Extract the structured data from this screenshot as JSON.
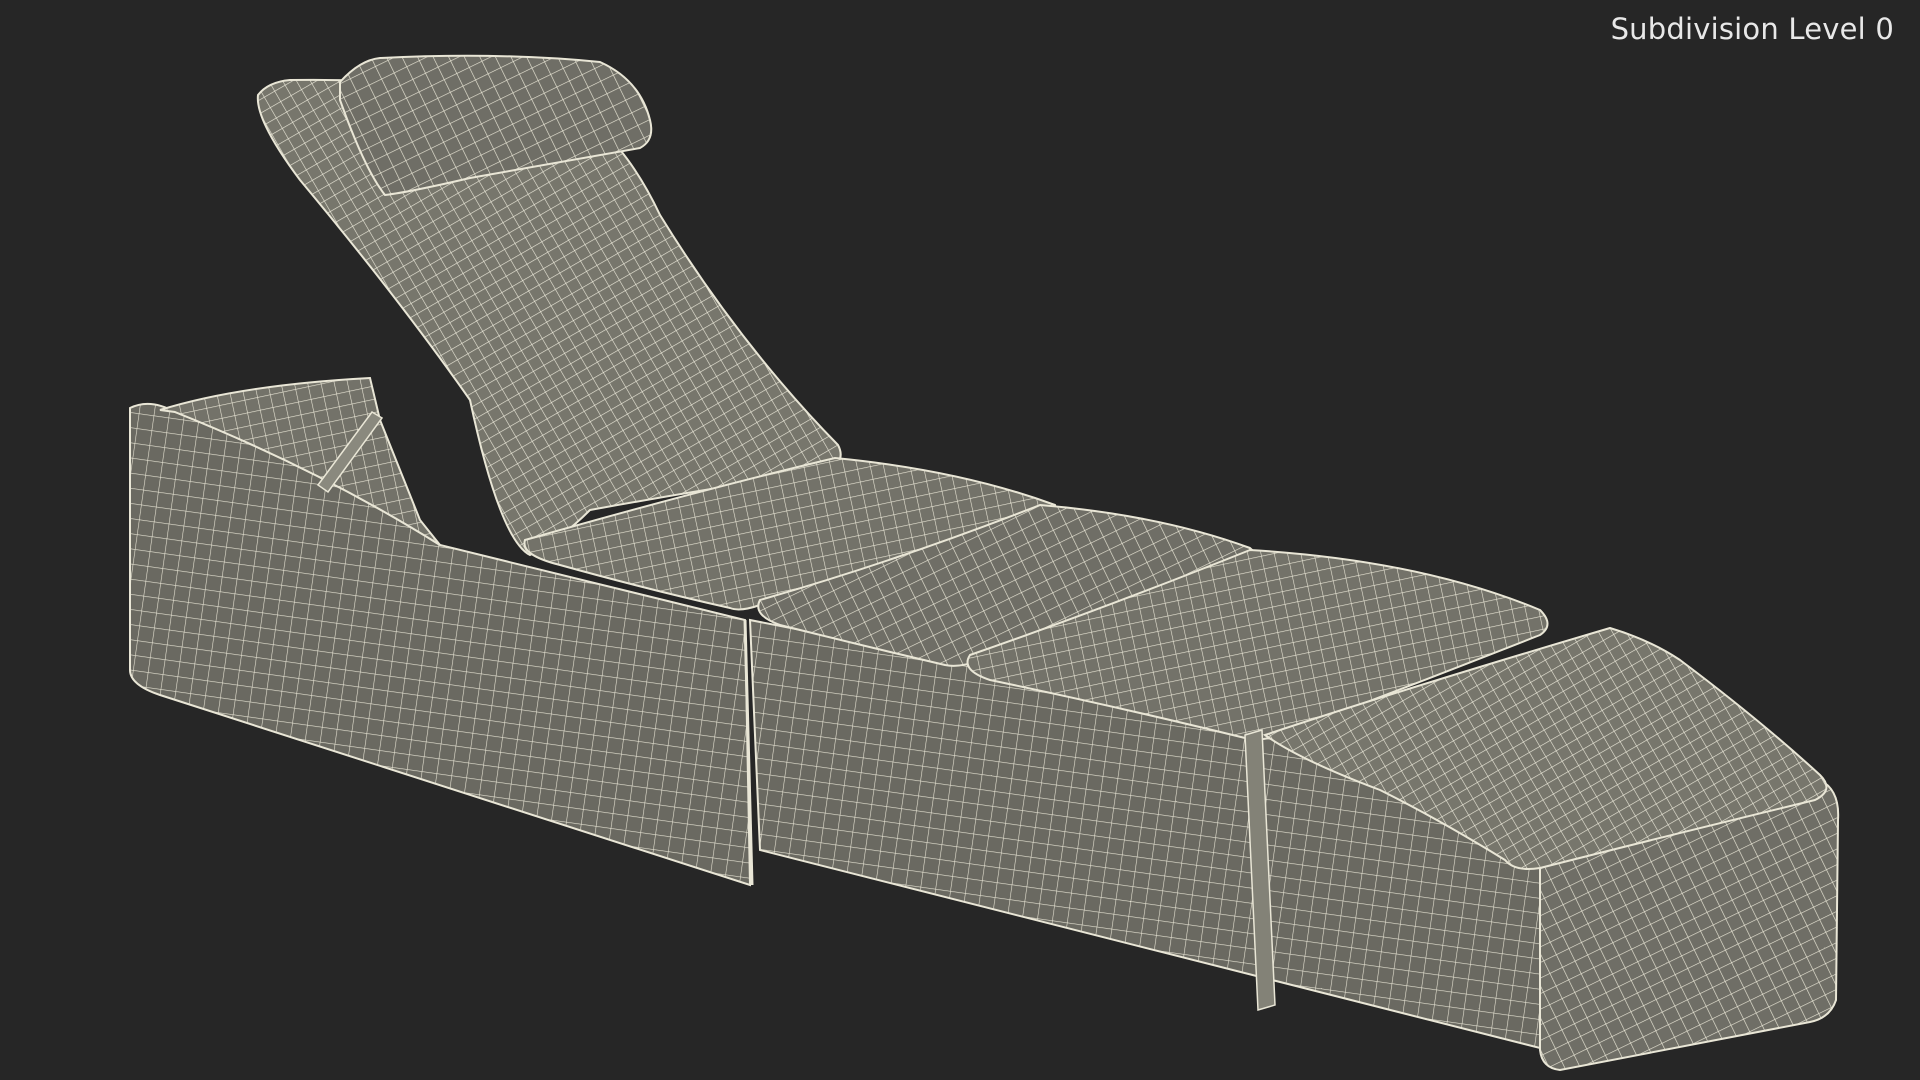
{
  "viewport": {
    "subdivision_label": "Subdivision Level 0",
    "background_color": "#262626",
    "mesh_fill_color": "#6f6e66",
    "wire_color": "#e9e6d6"
  },
  "model": {
    "icon": "lounge-chair-wireframe"
  }
}
